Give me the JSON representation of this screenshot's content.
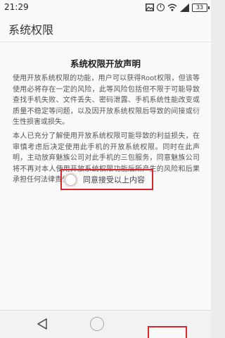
{
  "status_bar": {
    "time": "21:29",
    "battery": "33",
    "icons": [
      "image-icon",
      "clock-icon",
      "wifi-icon",
      "signal-icon",
      "battery-icon"
    ]
  },
  "app_bar": {
    "title": "系统权限"
  },
  "document": {
    "title": "系统权限开放声明",
    "paragraph_1": "使用开放系统权限的功能，用户可以获得Root权限，但该等使用必将存在一定的风险，此等风险包括但不限于可能导致查找手机失败、文件丢失、密码泄露、手机系统性能改变或质量不稳定等问题，以及因开放系统权限后导致的间接或衍生性损害或损失。",
    "paragraph_2": "本人已充分了解使用开放系统权限可能导致的利益损失，在审慎考虑后决定使用此手机的开放系统权限。同时在此声明，主动放弃魅族公司对此手机的三包服务，同意魅族公司将不再对本人使用开放系统权限功能后所产生的风险和后果承担任何法律责任。"
  },
  "agreement": {
    "label": "同意接受以上内容",
    "checked": false,
    "highlight_color": "#d9262d"
  },
  "nav_bar": {
    "icons": [
      "back-icon",
      "home-icon"
    ]
  }
}
